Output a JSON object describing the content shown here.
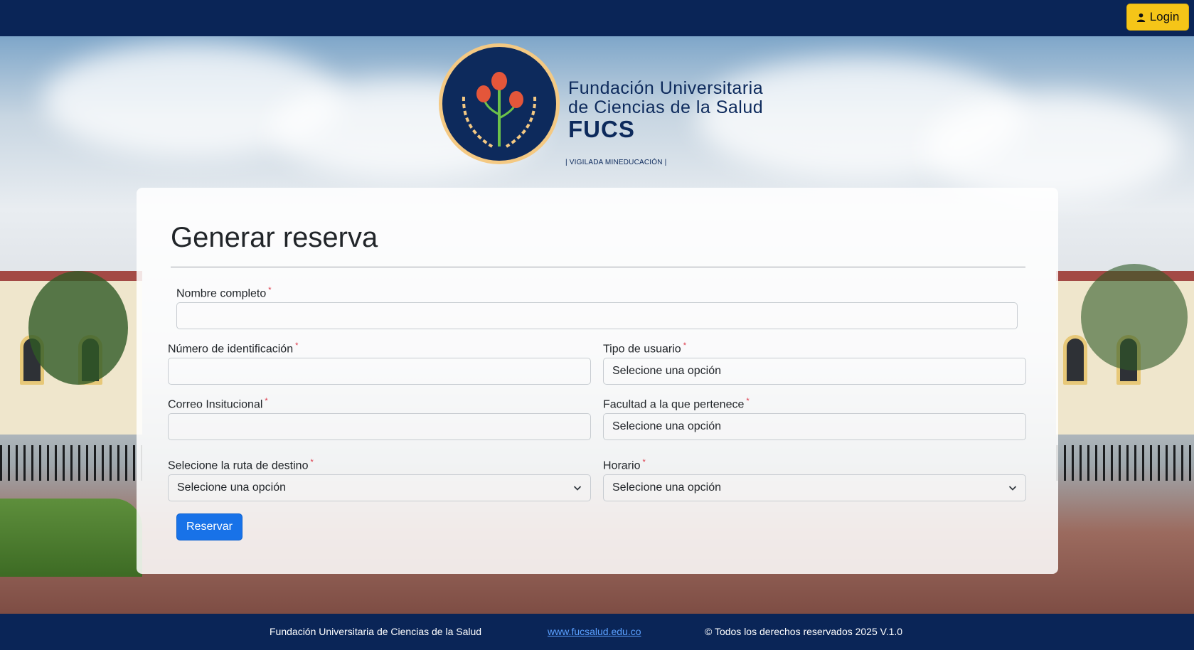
{
  "header": {
    "login_label": "Login",
    "accent_color": "#f5c518",
    "background_color": "#0a2557"
  },
  "logo": {
    "line1": "Fundación Universitaria",
    "line2": "de Ciencias de la Salud",
    "line3": "FUCS",
    "tagline": "| VIGILADA MINEDUCACIÓN |"
  },
  "form": {
    "title": "Generar reserva",
    "required_marker": "*",
    "fields": {
      "nombre": {
        "label": "Nombre completo",
        "value": "",
        "placeholder": ""
      },
      "identificacion": {
        "label": "Número de identificación",
        "value": "",
        "placeholder": ""
      },
      "tipo_usuario": {
        "label": "Tipo de usuario",
        "value": "Selecione una opción"
      },
      "correo": {
        "label": "Correo Insitucional",
        "value": "",
        "placeholder": ""
      },
      "facultad": {
        "label": "Facultad a la que pertenece",
        "value": "Selecione una opción"
      },
      "ruta": {
        "label": "Selecione la ruta de destino",
        "value": "Selecione una opción"
      },
      "horario": {
        "label": "Horario",
        "value": "Selecione una opción"
      }
    },
    "submit_label": "Reservar",
    "submit_color": "#1872e8"
  },
  "footer": {
    "org": "Fundación Universitaria de Ciencias de la Salud",
    "link": "www.fucsalud.edu.co",
    "rights": "© Todos los derechos reservados 2025 V.1.0"
  },
  "icons": {
    "login": "user-icon",
    "dropdown": "chevron-down-icon"
  }
}
